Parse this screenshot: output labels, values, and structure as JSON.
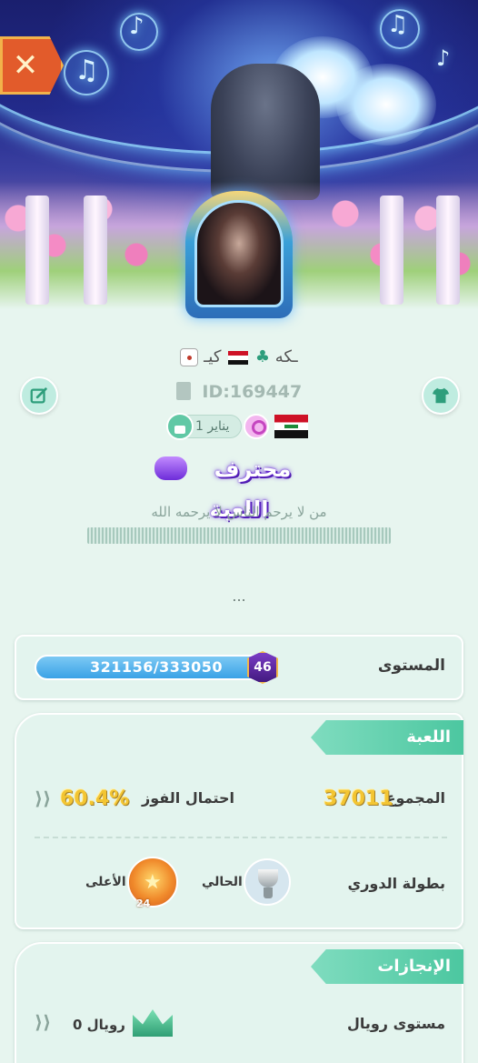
{
  "header": {
    "close_icon": "close-x-icon",
    "banner_theme": "music-astronaut-garden"
  },
  "profile": {
    "name_left": "كيـ",
    "name_right": "ـكه",
    "id_text": "ID:169447",
    "birthday": "1 يناير",
    "country": "Iraq",
    "title": "محترف اللعبة",
    "bio": "من لا يرحم الناس لا يرحمه الله",
    "more": "..."
  },
  "level": {
    "label": "المستوى",
    "progress_text": "321156/333050",
    "current": 321156,
    "target": 333050,
    "badge": "46"
  },
  "game": {
    "section_title": "اللعبة",
    "total_label": "المجموع",
    "total_value": "37011",
    "win_rate_label": "احتمال الفوز",
    "win_rate_value": "60.4%",
    "league_label": "بطولة الدوري",
    "current_label": "الحالي",
    "highest_label": "الأعلى",
    "medal_count": "24"
  },
  "achievements": {
    "section_title": "الإنجازات",
    "royal_label": "مستوى رويال",
    "royal_value": "رويال 0"
  },
  "colors": {
    "background": "#e7f5ef",
    "accent_green": "#4cc7a0",
    "gold": "#f3c532",
    "progress_blue": "#3aa2e6",
    "close_orange": "#e25b2b"
  }
}
